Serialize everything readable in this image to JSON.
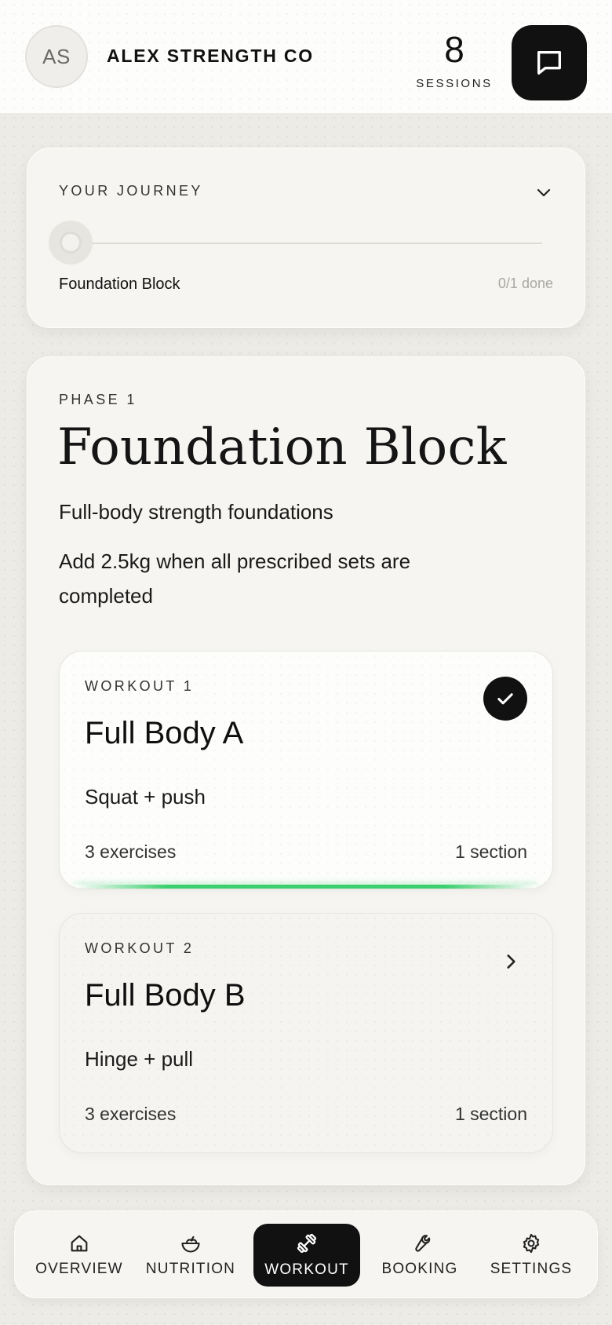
{
  "header": {
    "avatar_initials": "AS",
    "brand_name": "ALEX STRENGTH CO",
    "sessions_count": "8",
    "sessions_label": "SESSIONS",
    "chat_icon": "chat-bubble-icon"
  },
  "journey": {
    "label": "YOUR JOURNEY",
    "toggle_icon": "chevron-down-icon",
    "step_name": "Foundation Block",
    "step_progress": "0/1 done",
    "progress_fraction": 0
  },
  "phase": {
    "label": "PHASE 1",
    "title": "Foundation Block",
    "subtitle": "Full-body strength foundations",
    "note": "Add 2.5kg when all prescribed sets are completed",
    "workouts": [
      {
        "label": "WORKOUT 1",
        "title": "Full Body A",
        "description": "Squat + push",
        "exercises": "3 exercises",
        "sections": "1 section",
        "status": "completed",
        "status_icon": "check-icon"
      },
      {
        "label": "WORKOUT 2",
        "title": "Full Body B",
        "description": "Hinge + pull",
        "exercises": "3 exercises",
        "sections": "1 section",
        "status": "pending",
        "status_icon": "chevron-right-icon"
      }
    ]
  },
  "nav": {
    "items": [
      {
        "label": "OVERVIEW",
        "icon": "home-icon"
      },
      {
        "label": "NUTRITION",
        "icon": "bowl-icon"
      },
      {
        "label": "WORKOUT",
        "icon": "dumbbell-icon",
        "active": true
      },
      {
        "label": "BOOKING",
        "icon": "wrench-icon"
      },
      {
        "label": "SETTINGS",
        "icon": "gear-icon"
      }
    ]
  },
  "colors": {
    "accent_dark": "#111111",
    "progress_green": "#3ccf6e",
    "background": "#ecebe6"
  }
}
